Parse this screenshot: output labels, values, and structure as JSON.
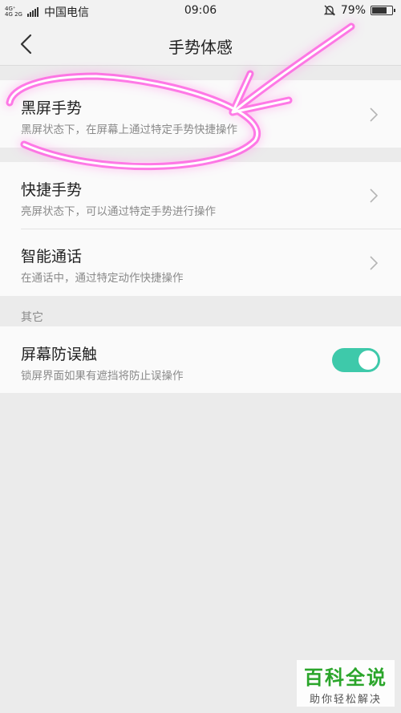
{
  "status_bar": {
    "network_top": "4G⁺",
    "network_bottom": "4G 2G",
    "carrier": "中国电信",
    "time": "09:06",
    "battery_level": "79%",
    "battery_fraction": 0.79
  },
  "header": {
    "title": "手势体感"
  },
  "items": [
    {
      "title": "黑屏手势",
      "subtitle": "黑屏状态下，在屏幕上通过特定手势快捷操作"
    },
    {
      "title": "快捷手势",
      "subtitle": "亮屏状态下，可以通过特定手势进行操作"
    },
    {
      "title": "智能通话",
      "subtitle": "在通话中，通过特定动作快捷操作"
    }
  ],
  "other_section": {
    "label": "其它",
    "toggle_item": {
      "title": "屏幕防误触",
      "subtitle": "锁屏界面如果有遮挡将防止误操作",
      "enabled": true
    }
  },
  "watermark": {
    "title": "百科全说",
    "subtitle": "助你轻松解决"
  },
  "colors": {
    "toggle_on": "#3ec9aa",
    "annotation": "#ff4fe0",
    "watermark_green": "#2aa52a"
  }
}
